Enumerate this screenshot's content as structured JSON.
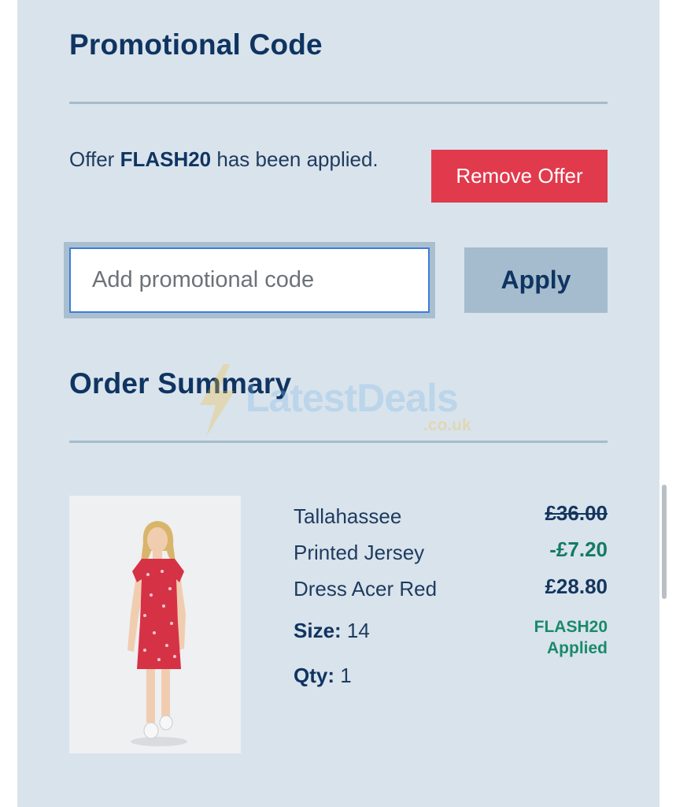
{
  "promo": {
    "heading": "Promotional Code",
    "offer_prefix": "Offer",
    "offer_code": "FLASH20",
    "offer_suffix": "has been applied.",
    "remove_label": "Remove Offer",
    "input_placeholder": "Add promotional code",
    "input_value": "",
    "apply_label": "Apply"
  },
  "summary": {
    "heading": "Order Summary"
  },
  "watermark": {
    "text": "LatestDeals",
    "sub": ".co.uk"
  },
  "item": {
    "name_lines": [
      "Tallahassee",
      "Printed Jersey",
      "Dress Acer Red"
    ],
    "size_label": "Size:",
    "size_value": "14",
    "qty_label": "Qty:",
    "qty_value": "1",
    "original_price": "£36.00",
    "discount": "-£7.20",
    "final_price": "£28.80",
    "applied_code": "FLASH20",
    "applied_text": "Applied"
  },
  "colors": {
    "panel_bg": "#d9e3ec",
    "brand_navy": "#0f3461",
    "remove_red": "#e03a4c",
    "discount_green": "#147b63",
    "dress_red": "#d63246"
  }
}
